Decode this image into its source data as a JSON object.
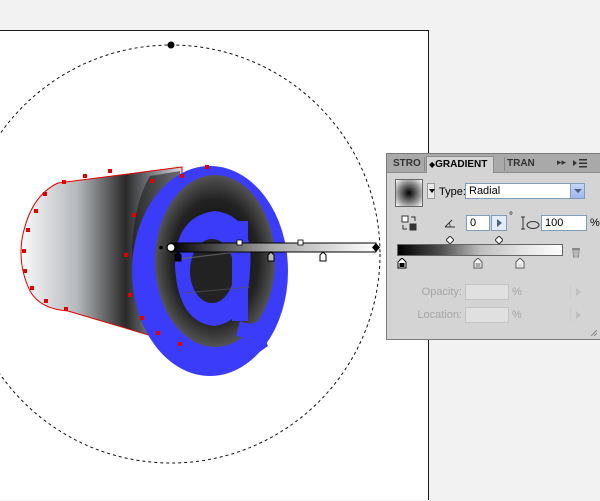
{
  "canvas": {
    "artwork_glyph": "@",
    "colors": {
      "glyph_blue": "#3b3bfa",
      "selection_red": "#e00000"
    }
  },
  "gradient_panel": {
    "tabs": {
      "stroke": "STRO",
      "gradient": "GRADIENT",
      "transparency": "TRAN"
    },
    "collapse_arrows": "▸▸",
    "type_label": "Type:",
    "type_value": "Radial",
    "angle_value": "0",
    "degree_symbol": "°",
    "aspect_ratio_value": "100",
    "aspect_ratio_unit": "%",
    "opacity_label": "Opacity:",
    "opacity_unit": "%",
    "location_label": "Location:",
    "location_unit": "%",
    "icons": {
      "menu": "panel-menu-icon",
      "reverse": "reverse-gradient-icon",
      "angle": "angle-icon",
      "aspect": "aspect-ratio-icon",
      "trash": "delete-stop-icon"
    }
  }
}
